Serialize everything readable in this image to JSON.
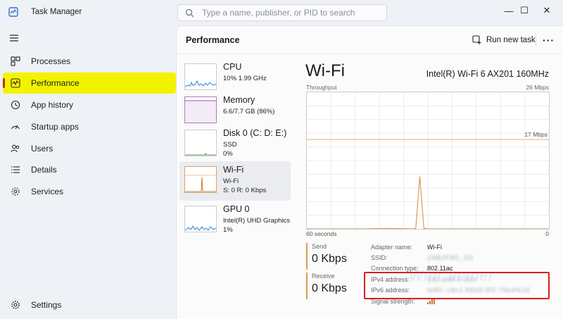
{
  "window": {
    "title": "Task Manager",
    "search_placeholder": "Type a name, publisher, or PID to search",
    "min_glyph": "—",
    "max_glyph": "☐",
    "close_glyph": "✕"
  },
  "sidebar": {
    "items": [
      {
        "label": "Processes",
        "icon": "processes-icon"
      },
      {
        "label": "Performance",
        "icon": "performance-icon",
        "active": true
      },
      {
        "label": "App history",
        "icon": "app-history-icon"
      },
      {
        "label": "Startup apps",
        "icon": "startup-apps-icon"
      },
      {
        "label": "Users",
        "icon": "users-icon"
      },
      {
        "label": "Details",
        "icon": "details-icon"
      },
      {
        "label": "Services",
        "icon": "services-icon"
      }
    ],
    "settings_label": "Settings"
  },
  "header": {
    "title": "Performance",
    "run_new_task": "Run new task",
    "more": "···"
  },
  "resources": [
    {
      "title": "CPU",
      "line1": "10%  1.99 GHz",
      "line2": ""
    },
    {
      "title": "Memory",
      "line1": "6.6/7.7 GB (86%)",
      "line2": ""
    },
    {
      "title": "Disk 0 (C: D: E:)",
      "line1": "SSD",
      "line2": "0%"
    },
    {
      "title": "Wi-Fi",
      "line1": "Wi-Fi",
      "line2": "S: 0  R: 0 Kbps",
      "selected": true
    },
    {
      "title": "GPU 0",
      "line1": "Intel(R) UHD Graphics",
      "line2": "1%"
    }
  ],
  "detail": {
    "title": "Wi-Fi",
    "adapter": "Intel(R) Wi-Fi 6 AX201 160MHz",
    "throughput_label": "Throughput",
    "max_label": "26 Mbps",
    "marker_label": "17 Mbps",
    "x_left": "60 seconds",
    "x_right": "0",
    "send_label": "Send",
    "send_value": "0 Kbps",
    "receive_label": "Receive",
    "receive_value": "0 Kbps",
    "props": [
      {
        "key": "Adapter name:",
        "value": "Wi-Fi",
        "blurred": false
      },
      {
        "key": "SSID:",
        "value": "1NB2F8C_5G",
        "blurred": true
      },
      {
        "key": "Connection type:",
        "value": "802.11ac",
        "blurred": false
      },
      {
        "key": "IPv4 address:",
        "value": "192.168.0.110",
        "blurred": true
      },
      {
        "key": "IPv6 address:",
        "value": "fe80::c8c1:b6d3:9f2:79e4%15",
        "blurred": true
      },
      {
        "key": "Signal strength:",
        "value": "",
        "blurred": false
      }
    ],
    "watermark": "WinCleaner"
  },
  "colors": {
    "accent_yellow": "#f3f300",
    "wifi_line": "#d99c55",
    "active_bar": "#c42b1c",
    "highlight_box": "#d8201a"
  },
  "chart_data": {
    "type": "line",
    "title": "",
    "xlabel": "",
    "ylabel": "",
    "xlim": [
      60,
      0
    ],
    "ylim": [
      0,
      26
    ],
    "unit": "Mbps",
    "series": [
      {
        "x": [
          60,
          45,
          40,
          34,
          33,
          32,
          31,
          30,
          24,
          12,
          0
        ],
        "y": [
          0,
          0,
          0.1,
          0,
          0.1,
          10,
          0.1,
          0,
          0,
          0,
          0
        ]
      }
    ]
  }
}
